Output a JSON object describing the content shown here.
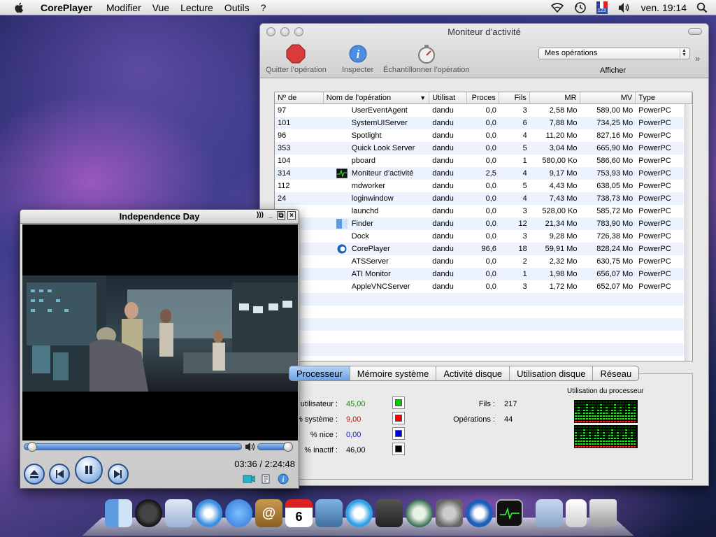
{
  "menubar": {
    "app": "CorePlayer",
    "items": [
      "Modifier",
      "Vue",
      "Lecture",
      "Outils",
      "?"
    ],
    "flag_text": "123",
    "clock": "ven. 19:14"
  },
  "activity_monitor": {
    "title": "Moniteur d’activité",
    "toolbar": {
      "quit": "Quitter l’opération",
      "inspect": "Inspecter",
      "sample": "Échantillonner l’opération"
    },
    "filter": {
      "selected": "Mes opérations",
      "label": "Afficher"
    },
    "columns": [
      "Nº de",
      "Nom de l’opération",
      "Utilisat",
      "Proces",
      "Fils",
      "MR",
      "MV",
      "Type"
    ],
    "rows": [
      {
        "pid": "97",
        "name": "UserEventAgent",
        "user": "dandu",
        "cpu": "0,0",
        "threads": "3",
        "rm": "2,58 Mo",
        "vm": "589,00 Mo",
        "type": "PowerPC"
      },
      {
        "pid": "101",
        "name": "SystemUIServer",
        "user": "dandu",
        "cpu": "0,0",
        "threads": "6",
        "rm": "7,88 Mo",
        "vm": "734,25 Mo",
        "type": "PowerPC"
      },
      {
        "pid": "96",
        "name": "Spotlight",
        "user": "dandu",
        "cpu": "0,0",
        "threads": "4",
        "rm": "11,20 Mo",
        "vm": "827,16 Mo",
        "type": "PowerPC"
      },
      {
        "pid": "353",
        "name": "Quick Look Server",
        "user": "dandu",
        "cpu": "0,0",
        "threads": "5",
        "rm": "3,04 Mo",
        "vm": "665,90 Mo",
        "type": "PowerPC"
      },
      {
        "pid": "104",
        "name": "pboard",
        "user": "dandu",
        "cpu": "0,0",
        "threads": "1",
        "rm": "580,00 Ko",
        "vm": "586,60 Mo",
        "type": "PowerPC"
      },
      {
        "pid": "314",
        "name": "Moniteur d’activité",
        "user": "dandu",
        "cpu": "2,5",
        "threads": "4",
        "rm": "9,17 Mo",
        "vm": "753,93 Mo",
        "type": "PowerPC"
      },
      {
        "pid": "112",
        "name": "mdworker",
        "user": "dandu",
        "cpu": "0,0",
        "threads": "5",
        "rm": "4,43 Mo",
        "vm": "638,05 Mo",
        "type": "PowerPC"
      },
      {
        "pid": "24",
        "name": "loginwindow",
        "user": "dandu",
        "cpu": "0,0",
        "threads": "4",
        "rm": "7,43 Mo",
        "vm": "738,73 Mo",
        "type": "PowerPC"
      },
      {
        "pid": "",
        "name": "launchd",
        "user": "dandu",
        "cpu": "0,0",
        "threads": "3",
        "rm": "528,00 Ko",
        "vm": "585,72 Mo",
        "type": "PowerPC"
      },
      {
        "pid": "",
        "name": "Finder",
        "user": "dandu",
        "cpu": "0,0",
        "threads": "12",
        "rm": "21,34 Mo",
        "vm": "783,90 Mo",
        "type": "PowerPC"
      },
      {
        "pid": "",
        "name": "Dock",
        "user": "dandu",
        "cpu": "0,0",
        "threads": "3",
        "rm": "9,28 Mo",
        "vm": "726,38 Mo",
        "type": "PowerPC"
      },
      {
        "pid": "",
        "name": "CorePlayer",
        "user": "dandu",
        "cpu": "96,6",
        "threads": "18",
        "rm": "59,91 Mo",
        "vm": "828,24 Mo",
        "type": "PowerPC"
      },
      {
        "pid": "",
        "name": "ATSServer",
        "user": "dandu",
        "cpu": "0,0",
        "threads": "2",
        "rm": "2,32 Mo",
        "vm": "630,75 Mo",
        "type": "PowerPC"
      },
      {
        "pid": "",
        "name": "ATI Monitor",
        "user": "dandu",
        "cpu": "0,0",
        "threads": "1",
        "rm": "1,98 Mo",
        "vm": "656,07 Mo",
        "type": "PowerPC"
      },
      {
        "pid": "",
        "name": "AppleVNCServer",
        "user": "dandu",
        "cpu": "0,0",
        "threads": "3",
        "rm": "1,72 Mo",
        "vm": "652,07 Mo",
        "type": "PowerPC"
      }
    ],
    "tabs": [
      "Processeur",
      "Mémoire système",
      "Activité disque",
      "Utilisation disque",
      "Réseau"
    ],
    "active_tab": "Processeur",
    "cpu_stats": {
      "user_label": "utilisateur :",
      "user_value": "45,00",
      "user_color": "#00cc00",
      "system_label": "% système :",
      "system_value": "9,00",
      "system_color": "#ee0000",
      "nice_label": "% nice :",
      "nice_value": "0,00",
      "nice_color": "#0000ee",
      "idle_label": "% inactif :",
      "idle_value": "46,00",
      "idle_color": "#000000",
      "threads_label": "Fils :",
      "threads_value": "217",
      "processes_label": "Opérations :",
      "processes_value": "44",
      "graph_title": "Utilisation du processeur"
    }
  },
  "coreplayer": {
    "title": "Independence Day",
    "position": "03:36",
    "duration": "2:24:48",
    "time_separator": "/"
  },
  "dock": {
    "apps": [
      "finder-icon",
      "dashboard-icon",
      "mail-icon",
      "safari-icon",
      "ichat-icon",
      "address-book-icon",
      "ical-icon",
      "iphoto-icon",
      "itunes-icon",
      "spaces-icon",
      "time-machine-icon",
      "system-preferences-icon",
      "coreplayer-icon",
      "activity-monitor-icon",
      "applications-folder-icon",
      "documents-stack-icon",
      "trash-icon"
    ],
    "ical_day": "6"
  },
  "colors": {
    "accent_blue": "#3b73c4",
    "table_stripe": "#edf3fe",
    "stop_red": "#d93a3a"
  }
}
